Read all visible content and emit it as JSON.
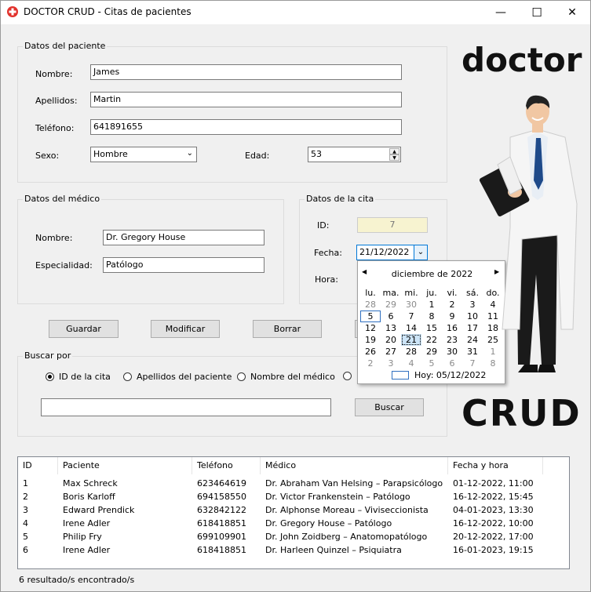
{
  "window": {
    "title": "DOCTOR CRUD - Citas de pacientes",
    "controls": [
      "—",
      "☐",
      "✕"
    ]
  },
  "patient": {
    "group_label": "Datos del paciente",
    "name_label": "Nombre:",
    "name_value": "James",
    "surname_label": "Apellidos:",
    "surname_value": "Martin",
    "phone_label": "Teléfono:",
    "phone_value": "641891655",
    "sex_label": "Sexo:",
    "sex_value": "Hombre",
    "age_label": "Edad:",
    "age_value": "53"
  },
  "doctor": {
    "group_label": "Datos del médico",
    "name_label": "Nombre:",
    "name_value": "Dr. Gregory House",
    "specialty_label": "Especialidad:",
    "specialty_value": "Patólogo"
  },
  "appointment": {
    "group_label": "Datos de la cita",
    "id_label": "ID:",
    "id_value": "7",
    "date_label": "Fecha:",
    "date_value": "21/12/2022",
    "time_label": "Hora:"
  },
  "calendar": {
    "month": "diciembre de 2022",
    "weekdays": [
      "lu.",
      "ma.",
      "mi.",
      "ju.",
      "vi.",
      "sá.",
      "do."
    ],
    "days": [
      {
        "t": "28",
        "dim": true
      },
      {
        "t": "29",
        "dim": true
      },
      {
        "t": "30",
        "dim": true
      },
      {
        "t": "1"
      },
      {
        "t": "2"
      },
      {
        "t": "3"
      },
      {
        "t": "4"
      },
      {
        "t": "5",
        "today": true
      },
      {
        "t": "6"
      },
      {
        "t": "7"
      },
      {
        "t": "8"
      },
      {
        "t": "9"
      },
      {
        "t": "10"
      },
      {
        "t": "11"
      },
      {
        "t": "12"
      },
      {
        "t": "13"
      },
      {
        "t": "14"
      },
      {
        "t": "15"
      },
      {
        "t": "16"
      },
      {
        "t": "17"
      },
      {
        "t": "18"
      },
      {
        "t": "19"
      },
      {
        "t": "20"
      },
      {
        "t": "21",
        "sel": true
      },
      {
        "t": "22"
      },
      {
        "t": "23"
      },
      {
        "t": "24"
      },
      {
        "t": "25"
      },
      {
        "t": "26"
      },
      {
        "t": "27"
      },
      {
        "t": "28"
      },
      {
        "t": "29"
      },
      {
        "t": "30"
      },
      {
        "t": "31"
      },
      {
        "t": "1",
        "dim": true
      },
      {
        "t": "2",
        "dim": true
      },
      {
        "t": "3",
        "dim": true
      },
      {
        "t": "4",
        "dim": true
      },
      {
        "t": "5",
        "dim": true
      },
      {
        "t": "6",
        "dim": true
      },
      {
        "t": "7",
        "dim": true
      },
      {
        "t": "8",
        "dim": true
      }
    ],
    "today_label": "Hoy: 05/12/2022"
  },
  "actions": {
    "save": "Guardar",
    "modify": "Modificar",
    "delete": "Borrar"
  },
  "search": {
    "group_label": "Buscar por",
    "options": [
      "ID de la cita",
      "Apellidos del paciente",
      "Nombre del médico"
    ],
    "selected_index": 0,
    "query": "",
    "button": "Buscar"
  },
  "branding": {
    "top_word": "doctor",
    "bottom_word": "CRUD"
  },
  "table": {
    "headers": [
      "ID",
      "Paciente",
      "Teléfono",
      "Médico",
      "Fecha y hora"
    ],
    "rows": [
      [
        "1",
        "Max Schreck",
        "623464619",
        "Dr. Abraham Van Helsing – Parapsicólogo",
        "01-12-2022, 11:00"
      ],
      [
        "2",
        "Boris Karloff",
        "694158550",
        "Dr. Victor Frankenstein – Patólogo",
        "16-12-2022, 15:45"
      ],
      [
        "3",
        "Edward Prendick",
        "632842122",
        "Dr. Alphonse Moreau – Viviseccionista",
        "04-01-2023, 13:30"
      ],
      [
        "4",
        "Irene Adler",
        "618418851",
        "Dr. Gregory House – Patólogo",
        "16-12-2022, 10:00"
      ],
      [
        "5",
        "Philip Fry",
        "699109901",
        "Dr. John Zoidberg – Anatomopatólogo",
        "20-12-2022, 17:00"
      ],
      [
        "6",
        "Irene Adler",
        "618418851",
        "Dr. Harleen Quinzel – Psiquiatra",
        "16-01-2023, 19:15"
      ]
    ]
  },
  "status": "6 resultado/s encontrado/s"
}
